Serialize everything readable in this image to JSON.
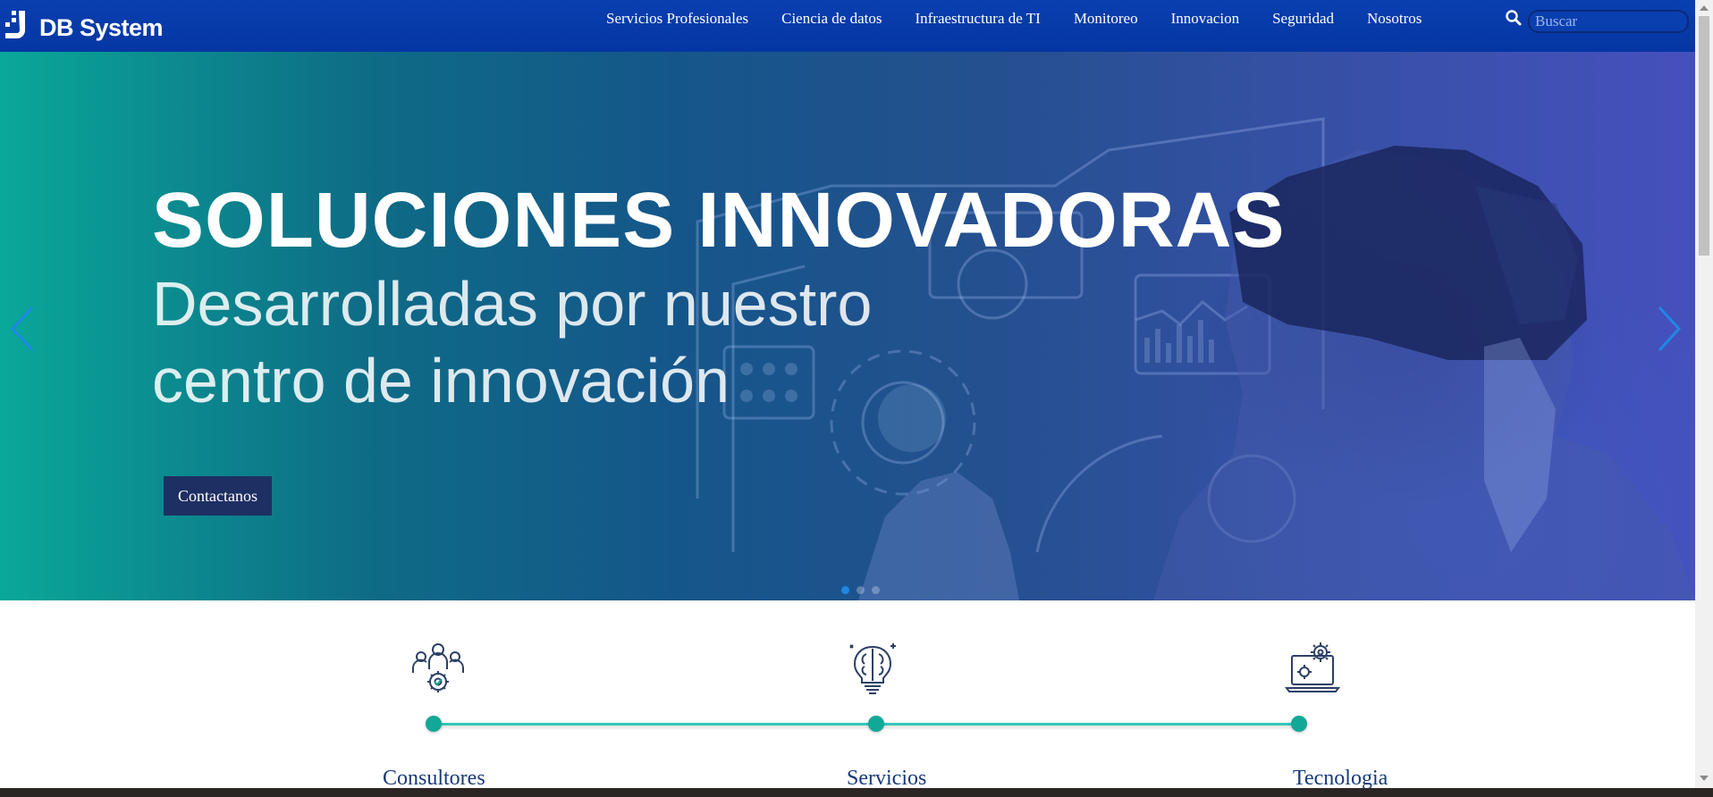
{
  "brand": {
    "name": "DB System",
    "logo_icon": "db-system-logo-icon"
  },
  "nav": {
    "items": [
      {
        "label": "Servicios Profesionales"
      },
      {
        "label": "Ciencia de datos"
      },
      {
        "label": "Infraestructura de TI"
      },
      {
        "label": "Monitoreo"
      },
      {
        "label": "Innovacion"
      },
      {
        "label": "Seguridad"
      },
      {
        "label": "Nosotros"
      }
    ],
    "search": {
      "icon": "search-icon",
      "placeholder": "Buscar",
      "value": ""
    }
  },
  "hero": {
    "title": "SOLUCIONES INNOVADORAS",
    "subtitle_line1": "Desarrolladas por nuestro",
    "subtitle_line2": "centro de innovación",
    "button_label": "Contactanos",
    "slide_count": 3,
    "active_slide": 1,
    "colors": {
      "gradient_start": "#0aa89a",
      "gradient_end": "#4650bd",
      "button_bg": "#1e2f63",
      "arrow": "#1e88e5"
    }
  },
  "features": [
    {
      "label": "Consultores",
      "icon": "team-gear-icon"
    },
    {
      "label": "Servicios",
      "icon": "brain-bulb-icon"
    },
    {
      "label": "Tecnologia",
      "icon": "laptop-gear-icon"
    }
  ],
  "colors": {
    "nav_bg": "#0a3fb0",
    "timeline": "#35c7b8",
    "timeline_dot": "#12a898",
    "feature_label": "#173a78"
  }
}
